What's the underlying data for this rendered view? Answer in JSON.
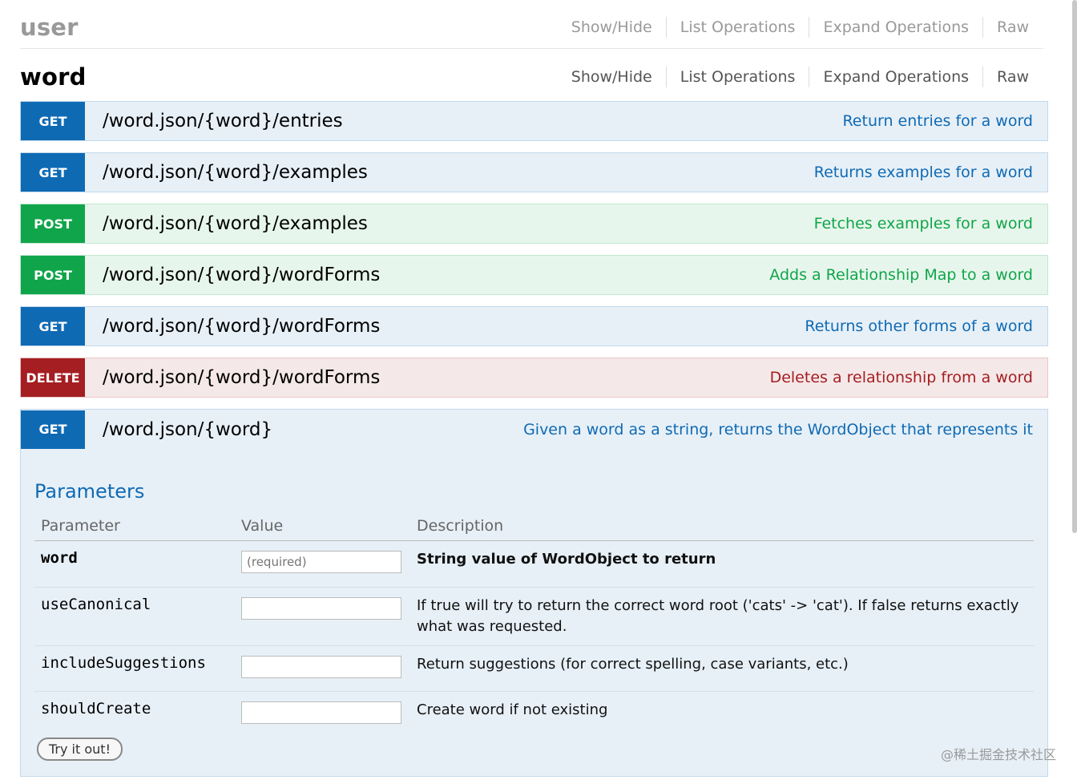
{
  "sections": {
    "user": {
      "title": "user",
      "links": [
        "Show/Hide",
        "List Operations",
        "Expand Operations",
        "Raw"
      ]
    },
    "word": {
      "title": "word",
      "links": [
        "Show/Hide",
        "List Operations",
        "Expand Operations",
        "Raw"
      ]
    }
  },
  "operations": [
    {
      "method": "GET",
      "path": "/word.json/{word}/entries",
      "summary": "Return entries for a word"
    },
    {
      "method": "GET",
      "path": "/word.json/{word}/examples",
      "summary": "Returns examples for a word"
    },
    {
      "method": "POST",
      "path": "/word.json/{word}/examples",
      "summary": "Fetches examples for a word"
    },
    {
      "method": "POST",
      "path": "/word.json/{word}/wordForms",
      "summary": "Adds a Relationship Map to a word"
    },
    {
      "method": "GET",
      "path": "/word.json/{word}/wordForms",
      "summary": "Returns other forms of a word"
    },
    {
      "method": "DELETE",
      "path": "/word.json/{word}/wordForms",
      "summary": "Deletes a relationship from a word"
    },
    {
      "method": "GET",
      "path": "/word.json/{word}",
      "summary": "Given a word as a string, returns the WordObject that represents it"
    }
  ],
  "parameters": {
    "title": "Parameters",
    "headers": {
      "parameter": "Parameter",
      "value": "Value",
      "description": "Description"
    },
    "rows": [
      {
        "name": "word",
        "placeholder": "(required)",
        "description": "String value of WordObject to return"
      },
      {
        "name": "useCanonical",
        "placeholder": "",
        "description": "If true will try to return the correct word root ('cats' -> 'cat'). If false returns exactly what was requested."
      },
      {
        "name": "includeSuggestions",
        "placeholder": "",
        "description": "Return suggestions (for correct spelling, case variants, etc.)"
      },
      {
        "name": "shouldCreate",
        "placeholder": "",
        "description": "Create word if not existing"
      }
    ],
    "try_button": "Try it out!"
  },
  "watermark": "@稀土掘金技术社区",
  "colors": {
    "get": "#0f6ab4",
    "post": "#10a54a",
    "delete": "#a41e22"
  }
}
